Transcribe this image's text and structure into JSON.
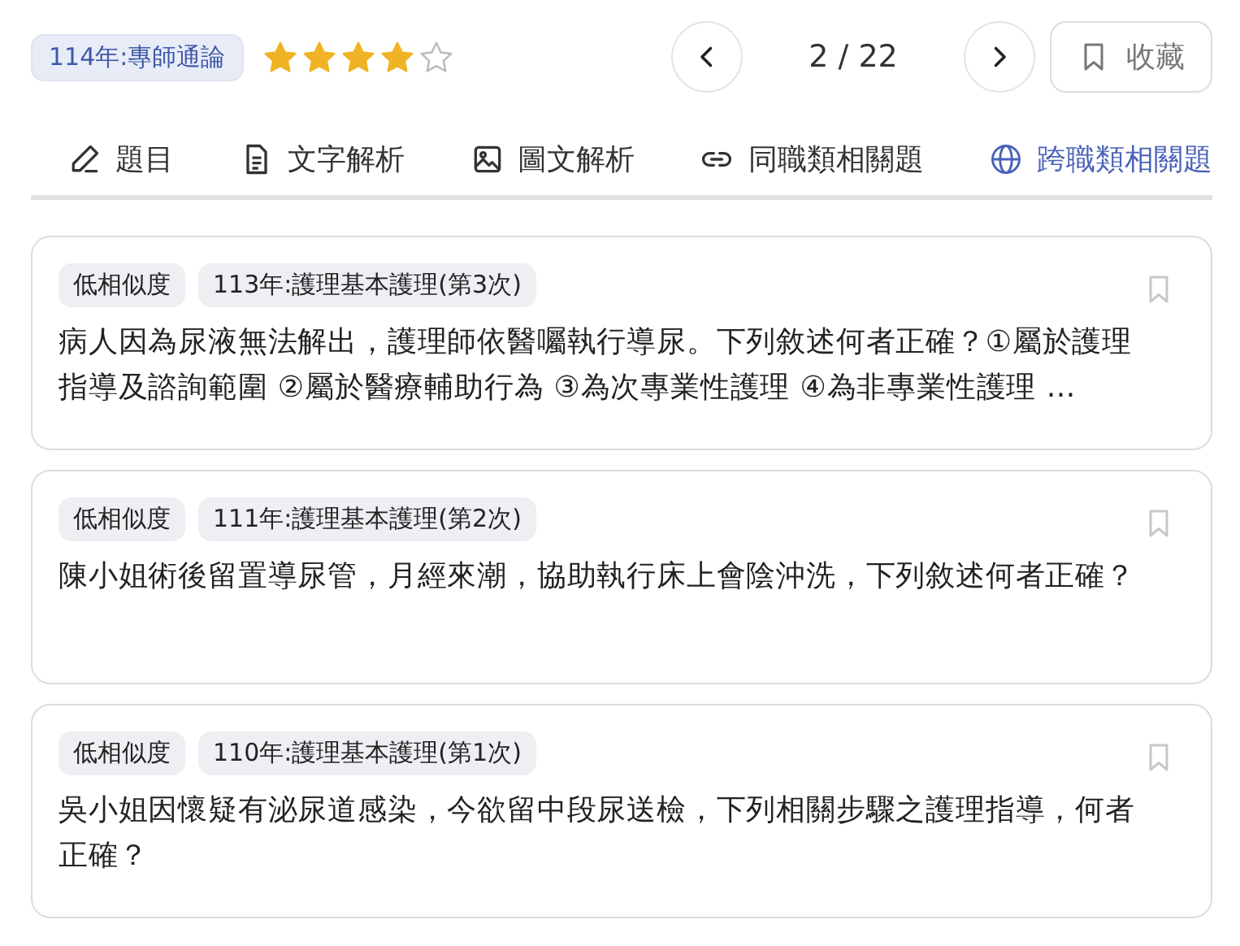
{
  "header": {
    "subject_tag": "114年:專師通論",
    "stars": 4,
    "page": "2 / 22",
    "bookmark_label": "收藏"
  },
  "tabs": [
    {
      "label": "題目",
      "kind": "pencil",
      "selected": false
    },
    {
      "label": "文字解析",
      "kind": "document",
      "selected": false
    },
    {
      "label": "圖文解析",
      "kind": "image",
      "selected": false
    },
    {
      "label": "同職類相關題",
      "kind": "link",
      "selected": false
    },
    {
      "label": "跨職類相關題",
      "kind": "globe",
      "selected": true
    }
  ],
  "questions": [
    {
      "similarity": "低相似度",
      "source": "113年:護理基本護理(第3次)",
      "text": "病人因為尿液無法解出，護理師依醫囑執行導尿。下列敘述何者正確？①屬於護理指導及諮詢範圍 ②屬於醫療輔助行為 ③為次專業性護理 ④為非專業性護理 …"
    },
    {
      "similarity": "低相似度",
      "source": "111年:護理基本護理(第2次)",
      "text": "陳小姐術後留置導尿管，月經來潮，協助執行床上會陰沖洗，下列敘述何者正確？"
    },
    {
      "similarity": "低相似度",
      "source": "110年:護理基本護理(第1次)",
      "text": "吳小姐因懷疑有泌尿道感染，今欲留中段尿送檢，下列相關步驟之護理指導，何者正確？"
    }
  ]
}
